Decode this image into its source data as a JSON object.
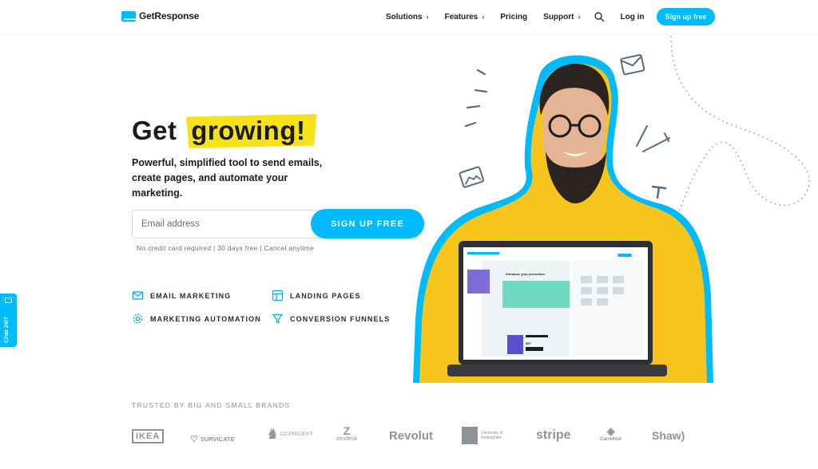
{
  "header": {
    "logo_text": "GetResponse",
    "nav": [
      {
        "label": "Solutions",
        "has_chevron": true
      },
      {
        "label": "Features",
        "has_chevron": true
      },
      {
        "label": "Pricing",
        "has_chevron": false
      },
      {
        "label": "Support",
        "has_chevron": true
      }
    ],
    "login_label": "Log in",
    "signup_label": "Sign up free"
  },
  "hero": {
    "title_plain": "Get",
    "title_highlight": "growing!",
    "subtitle": "Powerful, simplified tool to send emails, create pages, and automate your marketing.",
    "email_placeholder": "Email address",
    "cta_label": "SIGN UP FREE",
    "note": "No credit card required | 30 days free | Cancel anytime"
  },
  "features": [
    {
      "label": "EMAIL MARKETING",
      "icon": "envelope-icon"
    },
    {
      "label": "LANDING PAGES",
      "icon": "layout-icon"
    },
    {
      "label": "MARKETING AUTOMATION",
      "icon": "gear-icon"
    },
    {
      "label": "CONVERSION FUNNELS",
      "icon": "funnel-icon"
    }
  ],
  "chat": {
    "label": "Chat 24/7"
  },
  "trusted": {
    "heading": "TRUSTED BY BIG AND SMALL BRANDS",
    "brands": [
      "IKEA",
      "SURVICATE",
      "CD PROJEKT",
      "zendesk",
      "Revolut",
      "University of Nottingham",
      "stripe",
      "Carrefour",
      "Shaw)"
    ]
  },
  "mock_laptop": {
    "headline": "Introduce your promotion",
    "price": "$97"
  },
  "colors": {
    "accent": "#00baff",
    "highlight": "#f5e21a",
    "sweater": "#f6c41a"
  }
}
